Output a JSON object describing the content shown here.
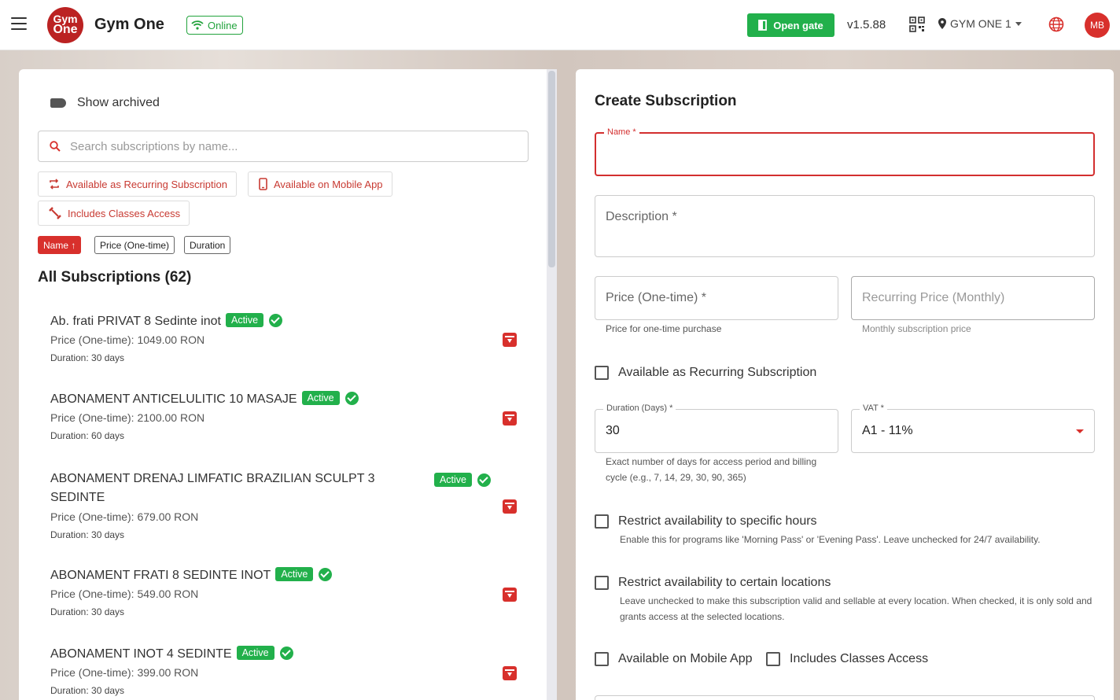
{
  "header": {
    "logo_top": "Gym",
    "logo_bottom": "One",
    "app_name": "Gym One",
    "status": "Online",
    "open_gate": "Open gate",
    "version": "v1.5.88",
    "location": "GYM ONE 1",
    "user_initials": "MB",
    "accent": "#d8302c",
    "success": "#22b04b"
  },
  "list_panel": {
    "show_archived": "Show archived",
    "search_placeholder": "Search subscriptions by name...",
    "filters": [
      "Available as Recurring Subscription",
      "Available on Mobile App",
      "Includes Classes Access"
    ],
    "sort": [
      {
        "label": "Name ↑",
        "active": true
      },
      {
        "label": "Price (One-time)",
        "active": false
      },
      {
        "label": "Duration",
        "active": false
      }
    ],
    "title": "All Subscriptions (62)",
    "items": [
      {
        "name": "Ab. frati PRIVAT 8 Sedinte inot",
        "status": "Active",
        "price": "Price (One-time): 1049.00 RON",
        "duration": "Duration: 30 days"
      },
      {
        "name": "ABONAMENT ANTICELULITIC 10 MASAJE",
        "status": "Active",
        "price": "Price (One-time): 2100.00 RON",
        "duration": "Duration: 60 days"
      },
      {
        "name": "ABONAMENT DRENAJ LIMFATIC BRAZILIAN SCULPT 3 SEDINTE",
        "status": "Active",
        "price": "Price (One-time): 679.00 RON",
        "duration": "Duration: 30 days"
      },
      {
        "name": "ABONAMENT FRATI 8 SEDINTE INOT",
        "status": "Active",
        "price": "Price (One-time): 549.00 RON",
        "duration": "Duration: 30 days"
      },
      {
        "name": "ABONAMENT INOT 4 SEDINTE",
        "status": "Active",
        "price": "Price (One-time): 399.00 RON",
        "duration": "Duration: 30 days"
      }
    ]
  },
  "form": {
    "title": "Create Subscription",
    "name_label": "Name *",
    "description_label": "Description *",
    "price_label": "Price (One-time) *",
    "price_helper": "Price for one-time purchase",
    "recurring_label": "Recurring Price (Monthly)",
    "recurring_helper": "Monthly subscription price",
    "recurring_checkbox": "Available as Recurring Subscription",
    "duration_label": "Duration (Days) *",
    "duration_value": "30",
    "duration_helper_1": "Exact number of days for access period and billing",
    "duration_helper_2": "cycle (e.g., 7, 14, 29, 30, 90, 365)",
    "vat_label": "VAT *",
    "vat_value": "A1 - 11%",
    "restrict_hours": "Restrict availability to specific hours",
    "restrict_hours_helper": "Enable this for programs like 'Morning Pass' or 'Evening Pass'. Leave unchecked for 24/7 availability.",
    "restrict_locations": "Restrict availability to certain locations",
    "restrict_locations_helper_1": "Leave unchecked to make this subscription valid and sellable at every location. When checked, it is only sold and",
    "restrict_locations_helper_2": "grants access at the selected locations.",
    "mobile_app": "Available on Mobile App",
    "classes_access": "Includes Classes Access"
  }
}
